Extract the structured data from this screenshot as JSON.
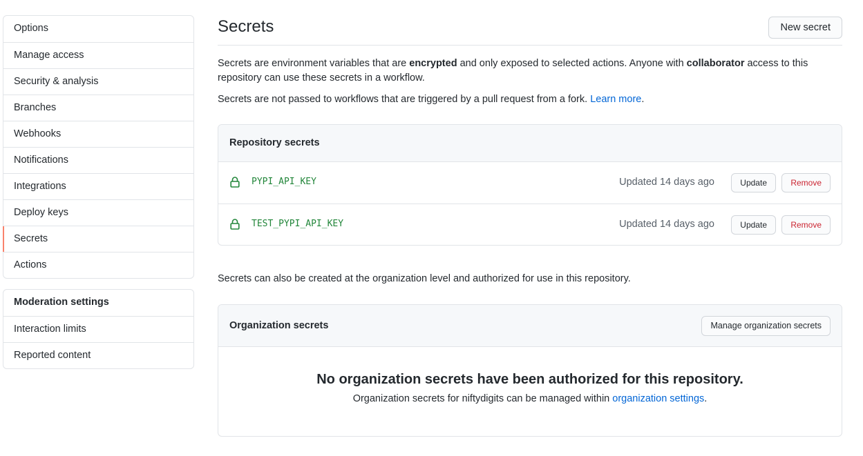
{
  "sidebar": {
    "items": [
      {
        "label": "Options"
      },
      {
        "label": "Manage access"
      },
      {
        "label": "Security & analysis"
      },
      {
        "label": "Branches"
      },
      {
        "label": "Webhooks"
      },
      {
        "label": "Notifications"
      },
      {
        "label": "Integrations"
      },
      {
        "label": "Deploy keys"
      },
      {
        "label": "Secrets",
        "selected": true
      },
      {
        "label": "Actions"
      }
    ],
    "moderation": {
      "heading": "Moderation settings",
      "items": [
        {
          "label": "Interaction limits"
        },
        {
          "label": "Reported content"
        }
      ]
    }
  },
  "header": {
    "title": "Secrets",
    "new_button": "New secret"
  },
  "description": {
    "p1_a": "Secrets are environment variables that are ",
    "p1_b": "encrypted",
    "p1_c": " and only exposed to selected actions. Anyone with ",
    "p1_d": "collaborator",
    "p1_e": " access to this repository can use these secrets in a workflow.",
    "p2_a": "Secrets are not passed to workflows that are triggered by a pull request from a fork. ",
    "p2_link": "Learn more",
    "p2_end": "."
  },
  "repo_secrets": {
    "title": "Repository secrets",
    "rows": [
      {
        "name": "PYPI_API_KEY",
        "updated": "Updated 14 days ago",
        "update_label": "Update",
        "remove_label": "Remove"
      },
      {
        "name": "TEST_PYPI_API_KEY",
        "updated": "Updated 14 days ago",
        "update_label": "Update",
        "remove_label": "Remove"
      }
    ]
  },
  "org_note": "Secrets can also be created at the organization level and authorized for use in this repository.",
  "org_secrets": {
    "title": "Organization secrets",
    "manage_button": "Manage organization secrets",
    "blank_title": "No organization secrets have been authorized for this repository.",
    "blank_text_a": "Organization secrets for niftydigits can be managed within ",
    "blank_link": "organization settings",
    "blank_text_end": "."
  },
  "colors": {
    "accent": "#f9826c",
    "link": "#0366d6",
    "secret_green": "#22863a",
    "danger": "#cb2431"
  },
  "icons": {
    "secret": "lock-icon"
  }
}
